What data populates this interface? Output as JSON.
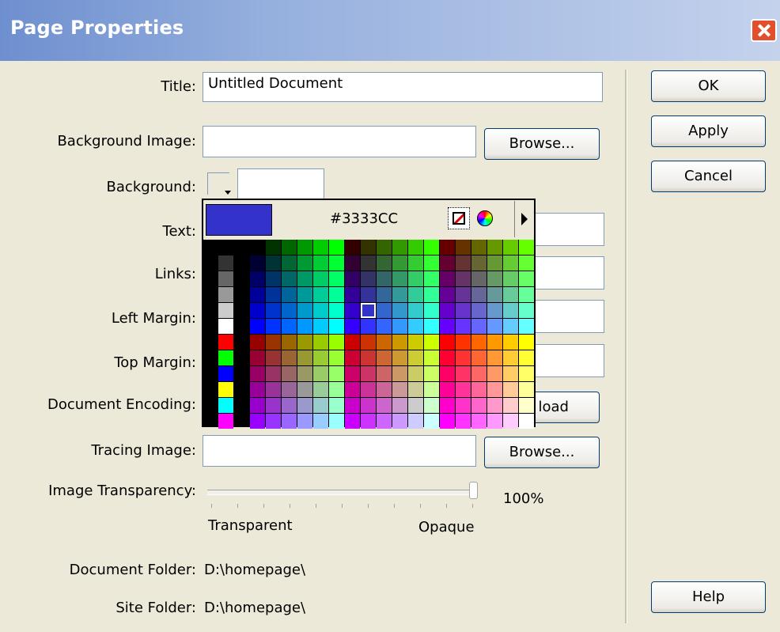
{
  "window": {
    "title": "Page Properties",
    "close_icon": "close-icon"
  },
  "form": {
    "title_label": "Title:",
    "title_value": "Untitled Document",
    "background_image_label": "Background Image:",
    "background_image_value": "",
    "browse_label": "Browse...",
    "background_label": "Background:",
    "text_label": "Text:",
    "links_label": "Links:",
    "left_margin_label": "Left Margin:",
    "top_margin_label": "Top Margin:",
    "document_encoding_label": "Document Encoding:",
    "reload_label_visible": "load",
    "tracing_image_label": "Tracing Image:",
    "tracing_image_value": "",
    "tracing_browse_label": "Browse...",
    "image_transparency_label": "Image Transparency:",
    "transparency_value": "100%",
    "transparency_level": 1.0,
    "transparent_label": "Transparent",
    "opaque_label": "Opaque",
    "document_folder_label": "Document Folder:",
    "document_folder_value": "D:\\homepage\\",
    "site_folder_label": "Site Folder:",
    "site_folder_value": "D:\\homepage\\"
  },
  "buttons": {
    "ok": "OK",
    "apply": "Apply",
    "cancel": "Cancel",
    "help": "Help"
  },
  "color_picker": {
    "hex": "#3333CC",
    "selected_color": "#3333CC",
    "no_color_icon": "no-color-icon",
    "color_wheel_icon": "color-wheel-icon",
    "menu_icon": "triangle-right-icon",
    "left_column_colors": [
      "#000000",
      "#333333",
      "#666666",
      "#999999",
      "#CCCCCC",
      "#FFFFFF",
      "#FF0000",
      "#00FF00",
      "#0000FF",
      "#FFFF00",
      "#00FFFF",
      "#FF00FF"
    ]
  }
}
